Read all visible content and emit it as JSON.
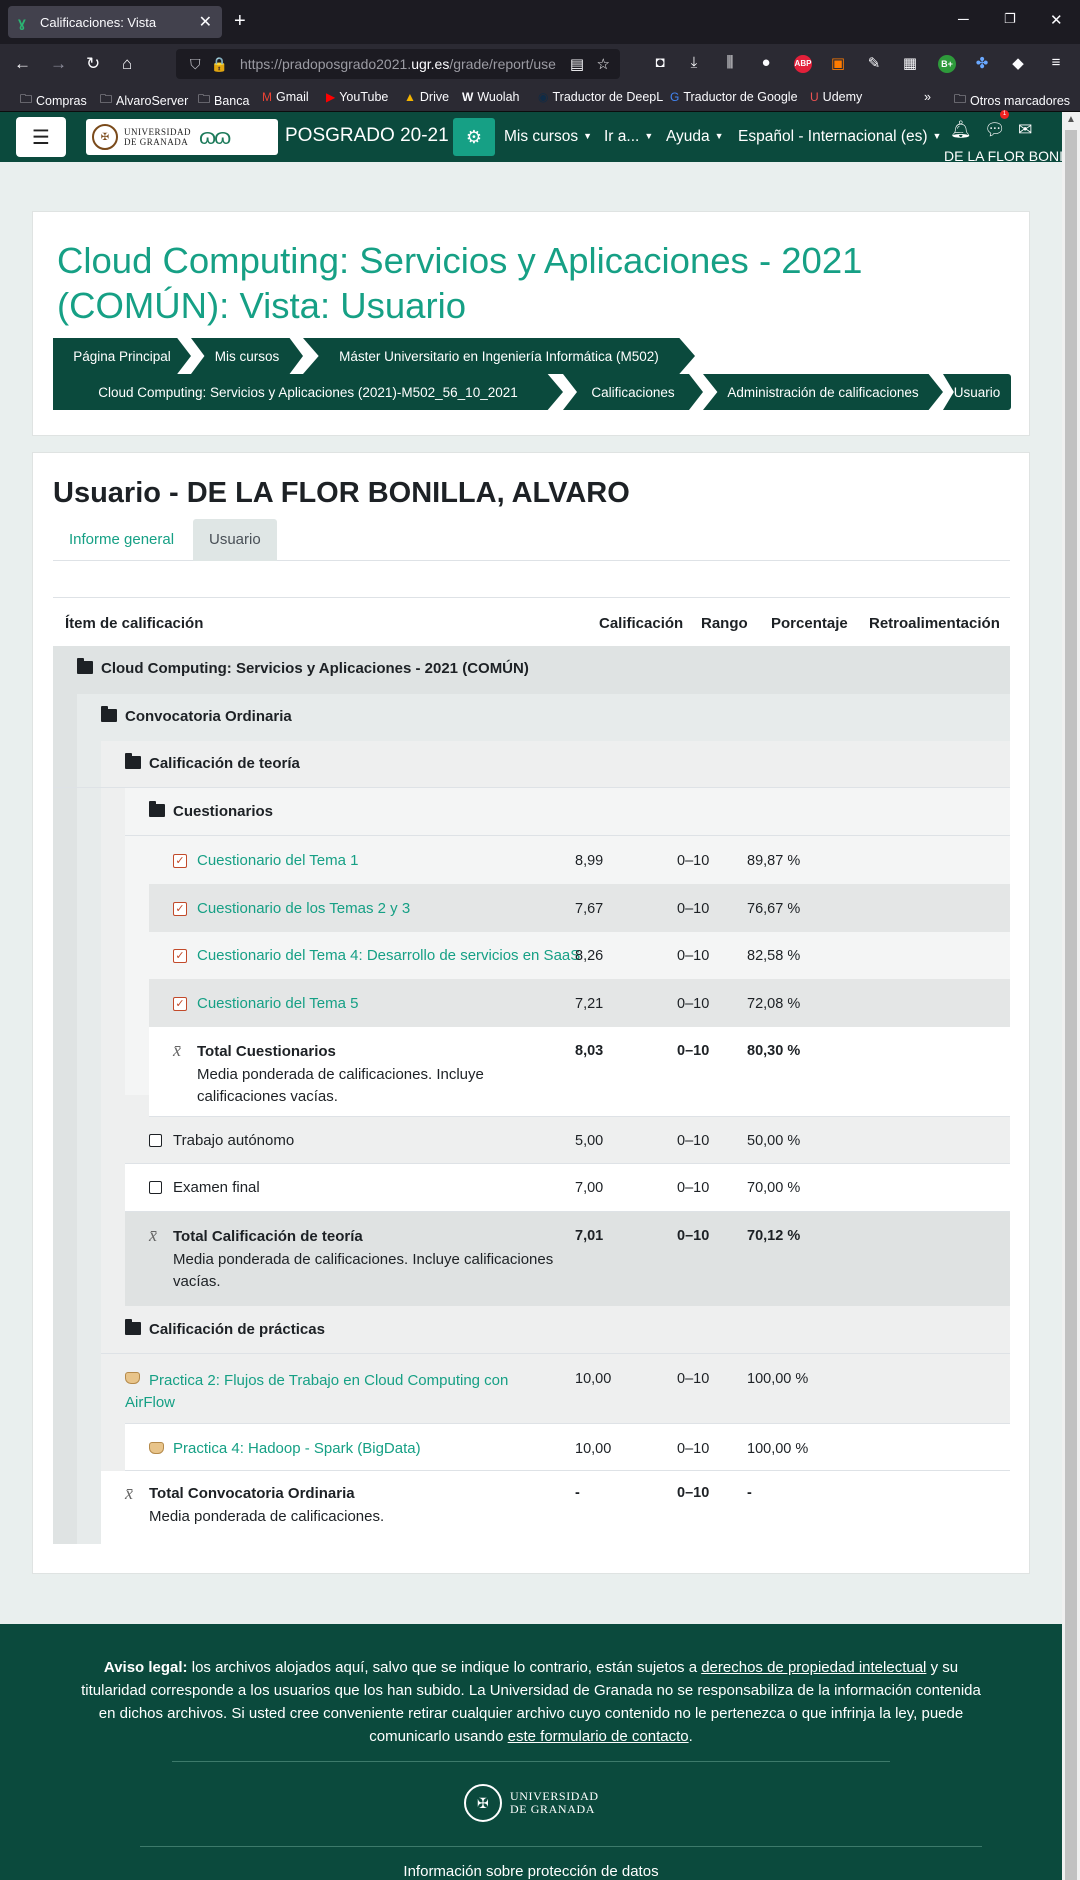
{
  "browser": {
    "tab_title": "Calificaciones: Vista",
    "url_host": "https://pradoposgrado2021.",
    "url_host2": "ugr.es",
    "url_path": "/grade/report/use",
    "bookmarks": [
      "Compras",
      "AlvaroServer",
      "Banca",
      "Gmail",
      "YouTube",
      "Drive",
      "Wuolah",
      "Traductor de DeepL",
      "Traductor de Google",
      "Udemy"
    ],
    "other_bookmarks": "Otros marcadores"
  },
  "moodle": {
    "brand_line1": "UNIVERSIDAD",
    "brand_line2": "DE GRANADA",
    "site": "POSGRADO 20-21",
    "nav": [
      "Mis cursos",
      "Ir a...",
      "Ayuda",
      "Español - Internacional (es)"
    ],
    "user_short": "DE LA FLOR BONILLA",
    "notif_count": "1"
  },
  "header": {
    "title": "Cloud Computing: Servicios y Aplicaciones - 2021 (COMÚN): Vista: Usuario",
    "crumbs": [
      "Página Principal",
      "Mis cursos",
      "Máster Universitario en Ingeniería Informática (M502)",
      "Cloud Computing: Servicios y Aplicaciones (2021)-M502_56_10_2021",
      "Calificaciones",
      "Administración de calificaciones",
      "Usuario"
    ]
  },
  "report": {
    "heading": "Usuario - DE LA FLOR BONILLA, ALVARO",
    "tabs": [
      "Informe general",
      "Usuario"
    ],
    "columns": [
      "Ítem de calificación",
      "Calificación",
      "Rango",
      "Porcentaje",
      "Retroalimentación"
    ],
    "course": "Cloud Computing: Servicios y Aplicaciones - 2021 (COMÚN)",
    "conv": "Convocatoria Ordinaria",
    "teoria": "Calificación de teoría",
    "cuest": "Cuestionarios",
    "items": [
      {
        "name": "Cuestionario del Tema 1",
        "grade": "8,99",
        "range": "0–10",
        "pct": "89,87 %"
      },
      {
        "name": "Cuestionario de los Temas 2 y 3",
        "grade": "7,67",
        "range": "0–10",
        "pct": "76,67 %"
      },
      {
        "name": "Cuestionario del Tema 4: Desarrollo de servicios en SaaS",
        "grade": "8,26",
        "range": "0–10",
        "pct": "82,58 %"
      },
      {
        "name": "Cuestionario del Tema 5",
        "grade": "7,21",
        "range": "0–10",
        "pct": "72,08 %"
      }
    ],
    "total_cuest": {
      "name": "Total Cuestionarios",
      "desc": "Media ponderada de calificaciones. Incluye calificaciones vacías.",
      "grade": "8,03",
      "range": "0–10",
      "pct": "80,30 %"
    },
    "trabajo": {
      "name": "Trabajo autónomo",
      "grade": "5,00",
      "range": "0–10",
      "pct": "50,00 %"
    },
    "examen": {
      "name": "Examen final",
      "grade": "7,00",
      "range": "0–10",
      "pct": "70,00 %"
    },
    "total_teoria": {
      "name": "Total Calificación de teoría",
      "desc": "Media ponderada de calificaciones. Incluye calificaciones vacías.",
      "grade": "7,01",
      "range": "0–10",
      "pct": "70,12 %"
    },
    "practicas": "Calificación de prácticas",
    "p2": {
      "name": "Practica 2: Flujos de Trabajo en Cloud Computing con AirFlow",
      "grade": "10,00",
      "range": "0–10",
      "pct": "100,00 %"
    },
    "p4": {
      "name": "Practica 4: Hadoop - Spark (BigData)",
      "grade": "10,00",
      "range": "0–10",
      "pct": "100,00 %"
    },
    "total_conv": {
      "name": "Total Convocatoria Ordinaria",
      "desc": "Media ponderada de calificaciones.",
      "grade": "-",
      "range": "0–10",
      "pct": "-"
    }
  },
  "footer": {
    "legal_label": "Aviso legal:",
    "legal_1": "los archivos alojados aquí, salvo que se indique lo contrario, están sujetos a",
    "legal_link1": "derechos de propiedad intelectual",
    "legal_2": "y su titularidad corresponde a los usuarios que los han subido. La Universidad de Granada no se responsabiliza de la información contenida en dichos archivos. Si usted cree conveniente retirar cualquier archivo cuyo contenido no le pertenezca o que infrinja la ley, puede comunicarlo usando",
    "legal_link2": "este formulario de contacto",
    "legal_end": ".",
    "logo1": "UNIVERSIDAD",
    "logo2": "DE GRANADA",
    "bottom": "Información sobre protección de datos"
  }
}
